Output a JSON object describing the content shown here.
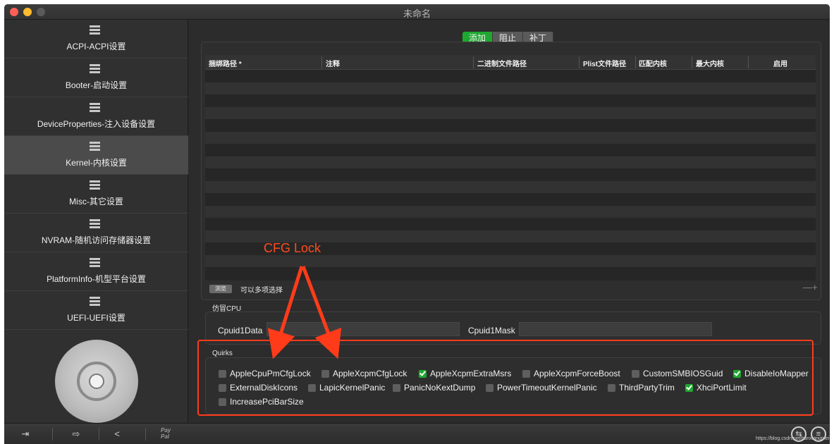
{
  "window": {
    "title": "未命名"
  },
  "sidebar": {
    "items": [
      {
        "label": "ACPI-ACPI设置"
      },
      {
        "label": "Booter-启动设置"
      },
      {
        "label": "DeviceProperties-注入设备设置"
      },
      {
        "label": "Kernel-内核设置"
      },
      {
        "label": "Misc-其它设置"
      },
      {
        "label": "NVRAM-随机访问存储器设置"
      },
      {
        "label": "PlatformInfo-机型平台设置"
      },
      {
        "label": "UEFI-UEFI设置"
      }
    ],
    "active_index": 3
  },
  "bottombar": {
    "paypal_line1": "Pay",
    "paypal_line2": "Pal",
    "watermark": "https://blog.csdn.net/hanxiangmei"
  },
  "segments": [
    {
      "label": "添加",
      "selected": true
    },
    {
      "label": "阻止",
      "selected": false
    },
    {
      "label": "补丁",
      "selected": false
    }
  ],
  "table": {
    "columns": [
      "捆绑路径 *",
      "注释",
      "二进制文件路径",
      "Plist文件路径",
      "匹配内核",
      "最大内核",
      "启用"
    ],
    "rows": []
  },
  "browse": {
    "button": "浏览",
    "hint": "可以多项选择",
    "plus_minus": "—+"
  },
  "cpu": {
    "section_title": "仿冒CPU",
    "cpuid1data_label": "Cpuid1Data",
    "cpuid1data_value": "",
    "cpuid1mask_label": "Cpuid1Mask",
    "cpuid1mask_value": ""
  },
  "quirks": {
    "section_title": "Quirks",
    "items": [
      {
        "label": "AppleCpuPmCfgLock",
        "checked": false
      },
      {
        "label": "AppleXcpmCfgLock",
        "checked": false
      },
      {
        "label": "AppleXcpmExtraMsrs",
        "checked": true
      },
      {
        "label": "AppleXcpmForceBoost",
        "checked": false
      },
      {
        "label": "CustomSMBIOSGuid",
        "checked": false
      },
      {
        "label": "DisableIoMapper",
        "checked": true
      },
      {
        "label": "ExternalDiskIcons",
        "checked": false
      },
      {
        "label": "LapicKernelPanic",
        "checked": false
      },
      {
        "label": "PanicNoKextDump",
        "checked": false
      },
      {
        "label": "PowerTimeoutKernelPanic",
        "checked": false
      },
      {
        "label": "ThirdPartyTrim",
        "checked": false
      },
      {
        "label": "XhciPortLimit",
        "checked": true
      },
      {
        "label": "IncreasePciBarSize",
        "checked": false
      }
    ]
  },
  "annotation": {
    "text": "CFG Lock",
    "color": "#ff3b1a"
  },
  "colors": {
    "accent_green": "#1ea830",
    "annotation_red": "#ff3b1a"
  }
}
